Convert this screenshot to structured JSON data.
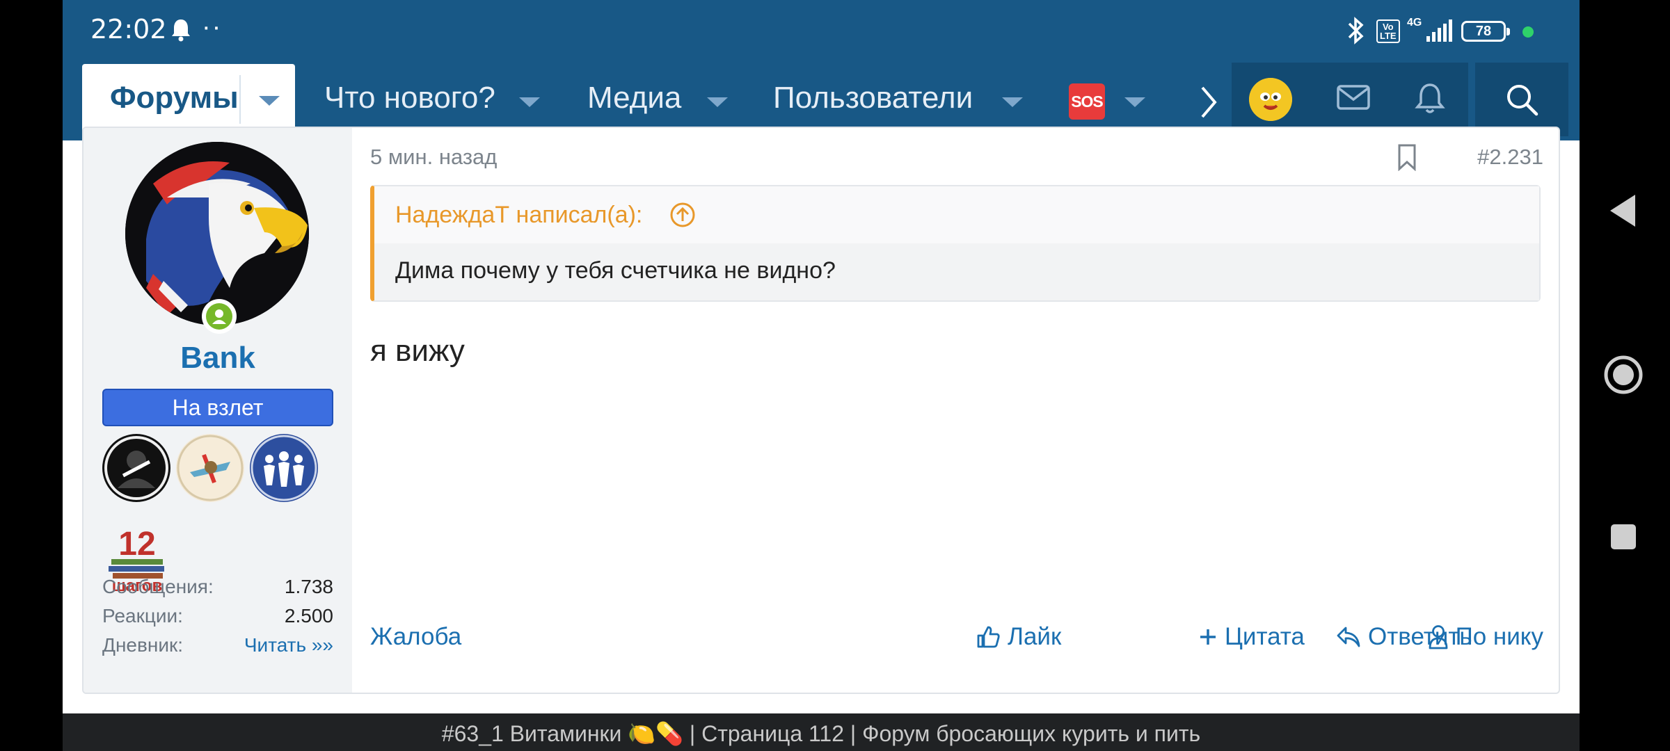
{
  "status_bar": {
    "time": "22:02",
    "dots": "··",
    "volte": "Vo\nLTE",
    "network": "4G",
    "battery": "78"
  },
  "nav": {
    "active_tab": "Форумы",
    "items": [
      {
        "label": "Что нового?"
      },
      {
        "label": "Медиа"
      },
      {
        "label": "Пользователи"
      }
    ],
    "sos_label": "SOS"
  },
  "post": {
    "date": "5 мин. назад",
    "number": "#2.231",
    "user": {
      "name": "Bank",
      "title": "На взлет",
      "badge_text": "12 шагов",
      "stats": [
        {
          "label": "Сообщения:",
          "value": "1.738"
        },
        {
          "label": "Реакции:",
          "value": "2.500"
        },
        {
          "label": "Дневник:",
          "value": "Читать »»"
        }
      ]
    },
    "quote": {
      "author": "НадеждаТ написал(а):",
      "text": "Дима почему у тебя счетчика не видно?"
    },
    "text": "я вижу",
    "actions": {
      "report": "Жалоба",
      "like": "Лайк",
      "quote": "Цитата",
      "reply": "Ответить",
      "mention": "По нику"
    }
  },
  "page_title": "#63_1 Витаминки 🍋💊 | Страница 112 | Форум бросающих курить и пить",
  "colors": {
    "header": "#185886",
    "accent": "#1b6fb0",
    "quote_author": "#e8982a",
    "title_badge": "#3c6ee0"
  }
}
